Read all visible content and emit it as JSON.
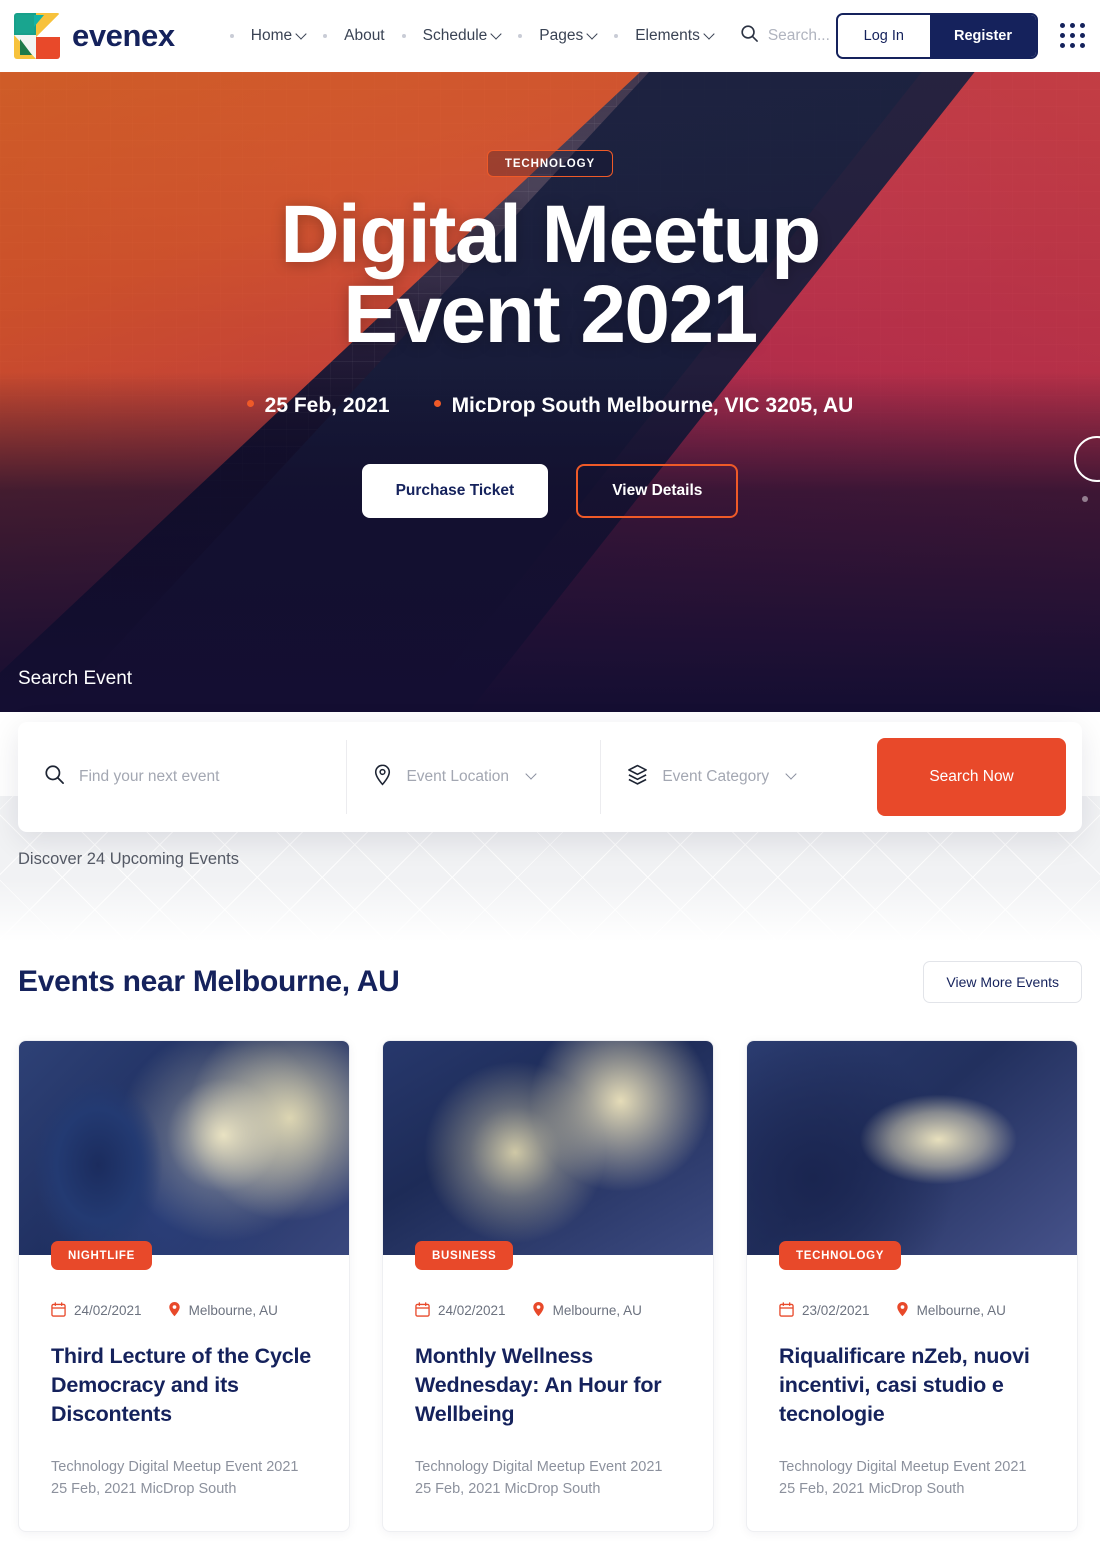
{
  "brand": {
    "name": "evenex"
  },
  "nav": {
    "items": [
      {
        "label": "Home",
        "has_dropdown": true
      },
      {
        "label": "About",
        "has_dropdown": false
      },
      {
        "label": "Schedule",
        "has_dropdown": true
      },
      {
        "label": "Pages",
        "has_dropdown": true
      },
      {
        "label": "Elements",
        "has_dropdown": true
      }
    ],
    "search_placeholder": "Search...",
    "login_label": "Log In",
    "register_label": "Register"
  },
  "hero": {
    "tag": "TECHNOLOGY",
    "title_line1": "Digital Meetup",
    "title_line2": "Event 2021",
    "date": "25 Feb, 2021",
    "location": "MicDrop South Melbourne, VIC 3205, AU",
    "primary_button": "Purchase Ticket",
    "secondary_button": "View Details"
  },
  "search": {
    "label": "Search Event",
    "keyword_placeholder": "Find your next event",
    "location_placeholder": "Event Location",
    "category_placeholder": "Event Category",
    "submit_label": "Search Now"
  },
  "discover": {
    "text": "Discover 24 Upcoming Events"
  },
  "events_section": {
    "title": "Events near Melbourne, AU",
    "view_more_label": "View More Events",
    "cards": [
      {
        "category": "NIGHTLIFE",
        "date": "24/02/2021",
        "location": "Melbourne, AU",
        "title": "Third Lecture of the Cycle Democracy and its Discontents",
        "description": "Technology Digital Meetup Event 2021 25 Feb, 2021 MicDrop South"
      },
      {
        "category": "BUSINESS",
        "date": "24/02/2021",
        "location": "Melbourne, AU",
        "title": "Monthly Wellness Wednesday: An Hour for Wellbeing",
        "description": "Technology Digital Meetup Event 2021 25 Feb, 2021 MicDrop South"
      },
      {
        "category": "TECHNOLOGY",
        "date": "23/02/2021",
        "location": "Melbourne, AU",
        "title": "Riqualificare nZeb, nuovi incentivi, casi studio e tecnologie",
        "description": "Technology Digital Meetup Event 2021 25 Feb, 2021 MicDrop South"
      }
    ]
  },
  "colors": {
    "accent_orange": "#e8492a",
    "brand_navy": "#15225c",
    "muted_text": "#8c919d"
  }
}
